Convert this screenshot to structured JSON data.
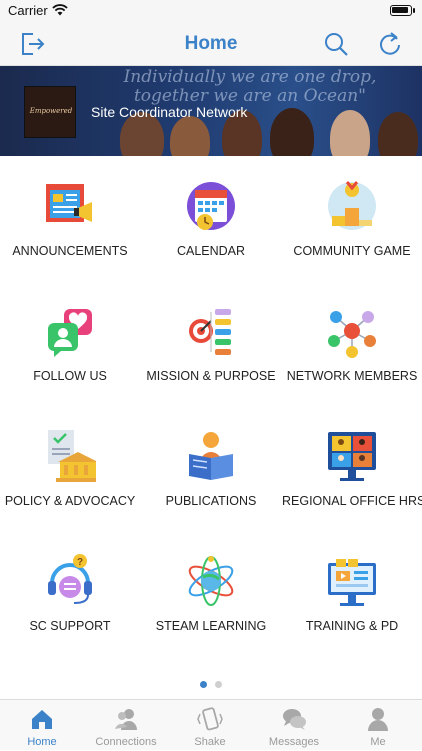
{
  "status_bar": {
    "carrier": "Carrier"
  },
  "nav": {
    "title": "Home",
    "left_icon": "logout-icon",
    "right_icons": [
      "search-icon",
      "refresh-icon"
    ],
    "accent": "#3b82c8"
  },
  "banner": {
    "quote": "Individually we are one drop, together we are an Ocean\"",
    "title": "Site Coordinator Network",
    "thumb_text": "Empowered"
  },
  "tiles": [
    {
      "label": "ANNOUNCEMENTS",
      "icon": "announcements-icon"
    },
    {
      "label": "CALENDAR",
      "icon": "calendar-icon"
    },
    {
      "label": "COMMUNITY GAME",
      "icon": "community-game-icon"
    },
    {
      "label": "FOLLOW US",
      "icon": "follow-us-icon"
    },
    {
      "label": "MISSION & PURPOSE",
      "icon": "mission-purpose-icon"
    },
    {
      "label": "NETWORK MEMBERS",
      "icon": "network-members-icon"
    },
    {
      "label": "POLICY & ADVOCACY",
      "icon": "policy-advocacy-icon"
    },
    {
      "label": "PUBLICATIONS",
      "icon": "publications-icon"
    },
    {
      "label": "REGIONAL OFFICE HRS",
      "icon": "regional-office-icon"
    },
    {
      "label": "SC SUPPORT",
      "icon": "sc-support-icon"
    },
    {
      "label": "STEAM LEARNING",
      "icon": "steam-learning-icon"
    },
    {
      "label": "TRAINING & PD",
      "icon": "training-pd-icon"
    }
  ],
  "pager": {
    "pages": 2,
    "current": 1,
    "active_color": "#3b82c8",
    "inactive_color": "#cfcfcf"
  },
  "tabs": [
    {
      "label": "Home",
      "icon": "home-icon",
      "active": true
    },
    {
      "label": "Connections",
      "icon": "connections-icon",
      "active": false
    },
    {
      "label": "Shake",
      "icon": "shake-icon",
      "active": false
    },
    {
      "label": "Messages",
      "icon": "messages-icon",
      "active": false
    },
    {
      "label": "Me",
      "icon": "person-icon",
      "active": false
    }
  ]
}
